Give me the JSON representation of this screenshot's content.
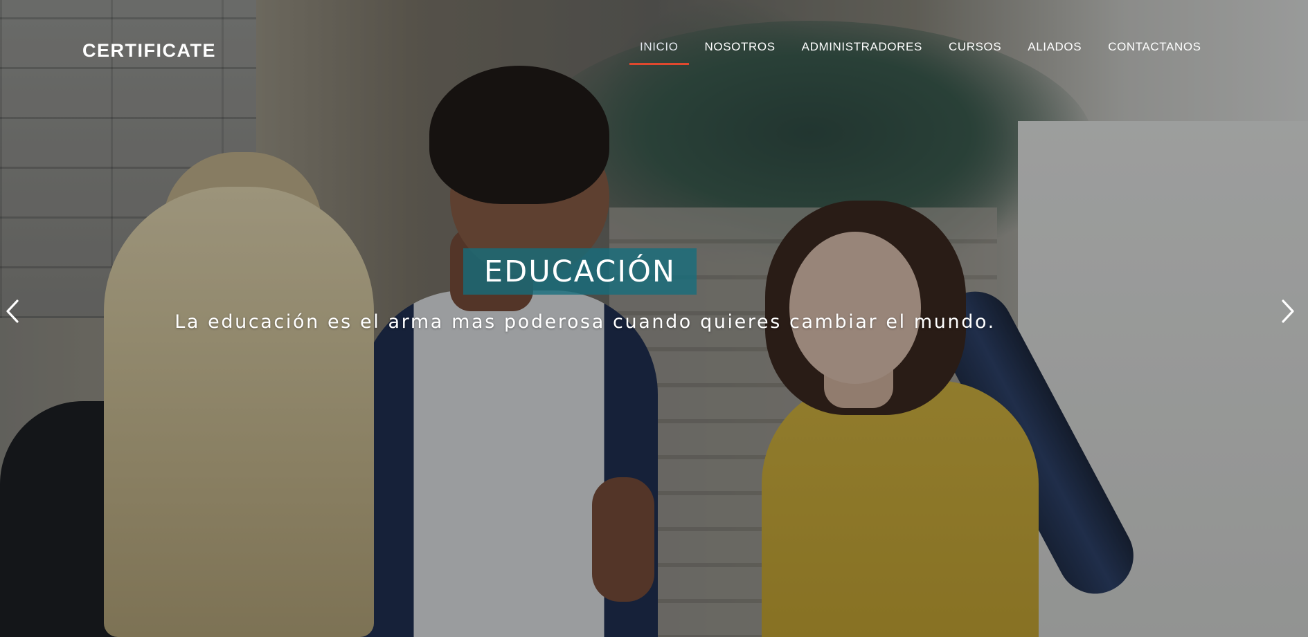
{
  "brand": {
    "name": "CERTIFICATE"
  },
  "nav": {
    "items": [
      {
        "label": "INICIO",
        "active": true
      },
      {
        "label": "NOSOTROS",
        "active": false
      },
      {
        "label": "ADMINISTRADORES",
        "active": false
      },
      {
        "label": "CURSOS",
        "active": false
      },
      {
        "label": "ALIADOS",
        "active": false
      },
      {
        "label": "CONTACTANOS",
        "active": false
      }
    ]
  },
  "slide": {
    "title": "EDUCACIÓN",
    "text": "La educación es el arma mas poderosa cuando quieres cambiar el mundo."
  },
  "carousel": {
    "prev_icon": "chevron-left-icon",
    "next_icon": "chevron-right-icon"
  },
  "colors": {
    "accent": "#e0482e",
    "caption_box": "#146e7d",
    "text": "#ffffff"
  }
}
